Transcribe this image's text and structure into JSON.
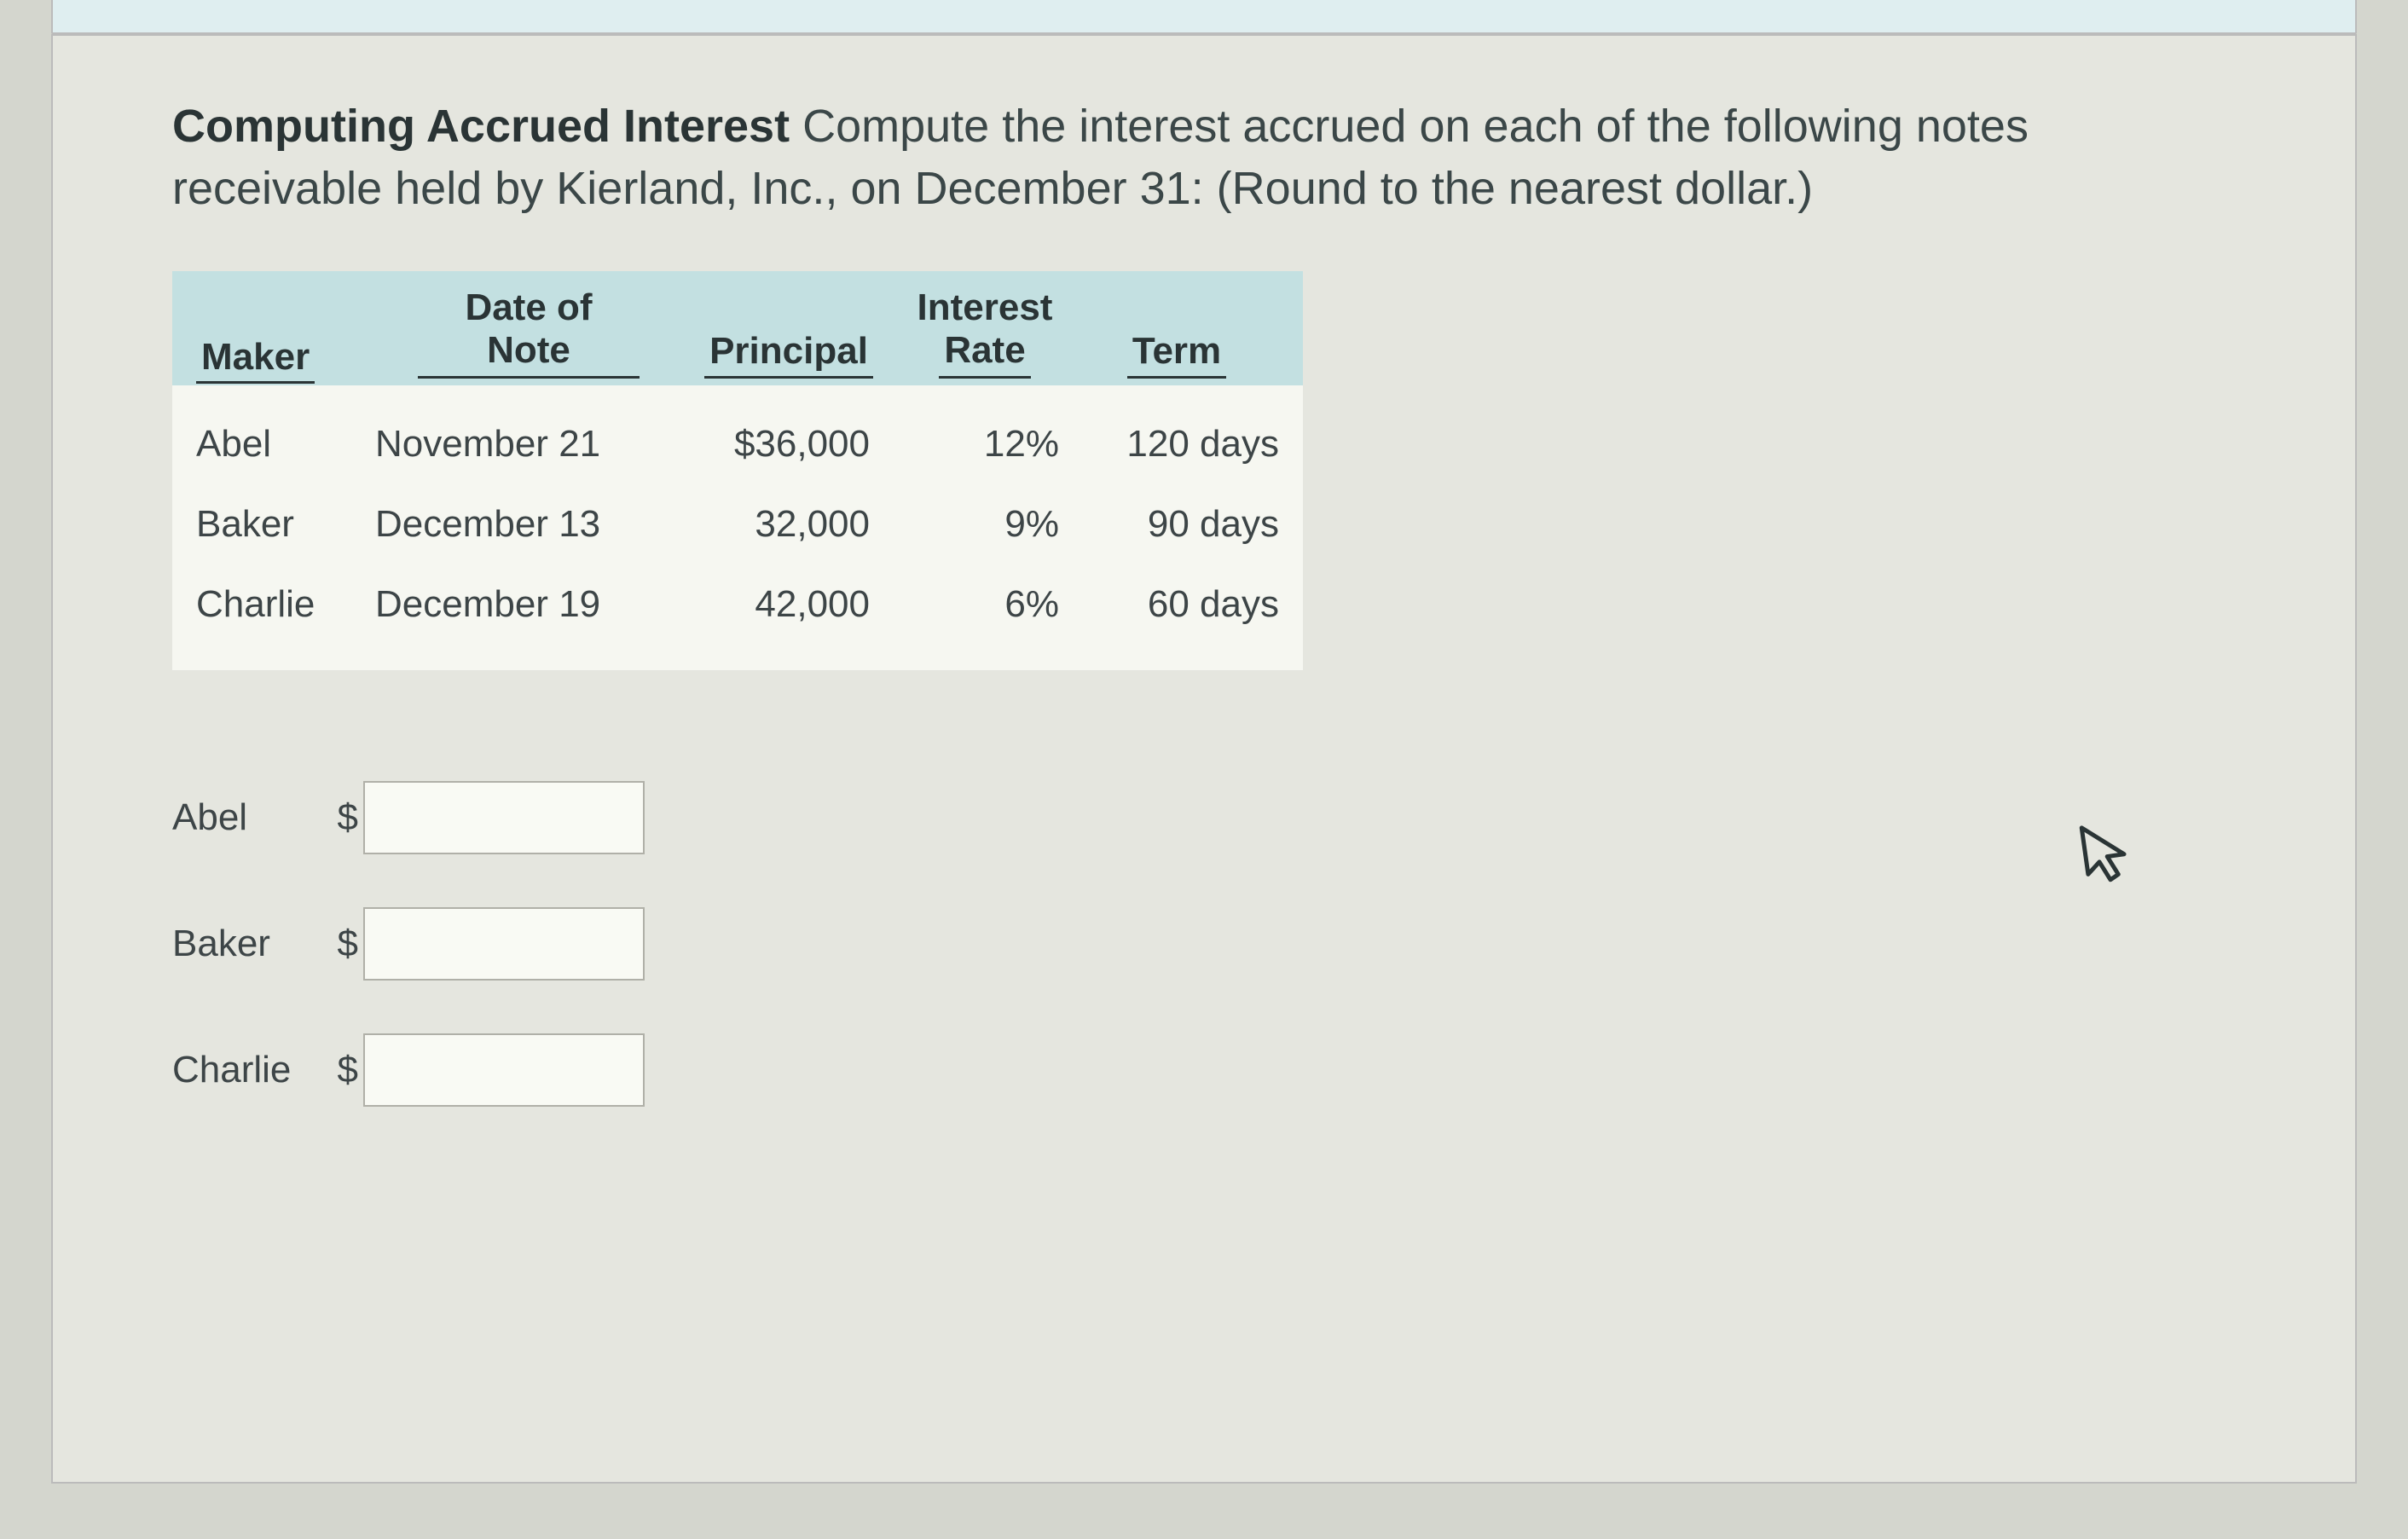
{
  "prompt": {
    "bold": "Computing Accrued Interest",
    "rest": " Compute the interest accrued on each of the following notes receivable held by Kierland, Inc., on December 31: (Round to the nearest dollar.)"
  },
  "table": {
    "headers": {
      "maker": "Maker",
      "date_top": "Date of",
      "date_bot": "Note",
      "principal": "Principal",
      "rate_top": "Interest",
      "rate_bot": "Rate",
      "term": "Term"
    },
    "rows": [
      {
        "maker": "Abel",
        "date": "November 21",
        "principal": "$36,000",
        "rate": "12%",
        "term": "120 days"
      },
      {
        "maker": "Baker",
        "date": "December 13",
        "principal": "32,000",
        "rate": "9%",
        "term": "90 days"
      },
      {
        "maker": "Charlie",
        "date": "December 19",
        "principal": "42,000",
        "rate": "6%",
        "term": "60 days"
      }
    ]
  },
  "answers": {
    "currency": "$",
    "rows": [
      {
        "label": "Abel",
        "value": ""
      },
      {
        "label": "Baker",
        "value": ""
      },
      {
        "label": "Charlie",
        "value": ""
      }
    ]
  }
}
